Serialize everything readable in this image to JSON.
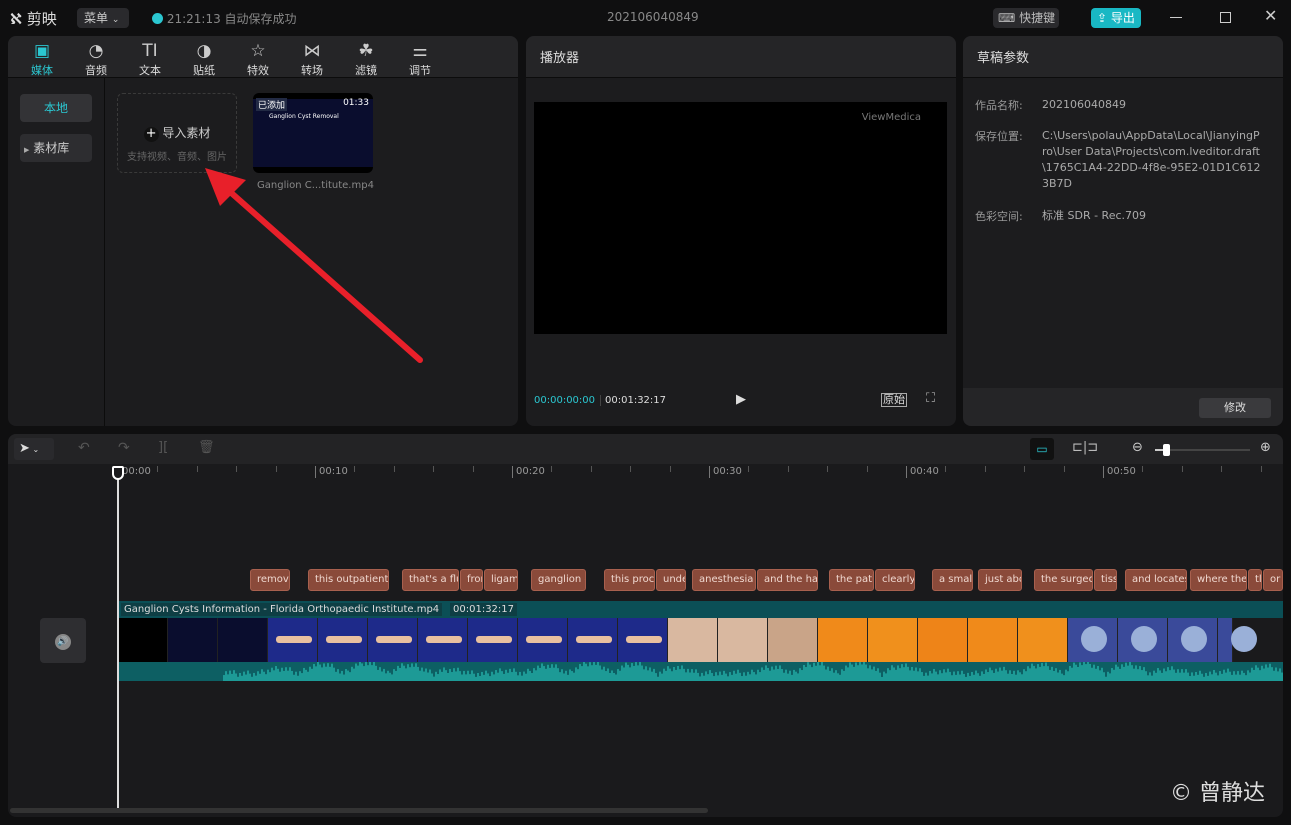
{
  "app": {
    "logo_text": "剪映",
    "menu_label": "菜单",
    "save_status": "21:21:13 自动保存成功",
    "project_title": "202106040849",
    "shortcuts_label": "快捷键",
    "export_label": "导出",
    "accent": "#2bc7d1"
  },
  "media_tabs": [
    {
      "label": "媒体",
      "icon": "media-icon",
      "active": true
    },
    {
      "label": "音频",
      "icon": "audio-icon"
    },
    {
      "label": "文本",
      "icon": "text-icon"
    },
    {
      "label": "贴纸",
      "icon": "sticker-icon"
    },
    {
      "label": "特效",
      "icon": "effects-icon"
    },
    {
      "label": "转场",
      "icon": "transition-icon"
    },
    {
      "label": "滤镜",
      "icon": "filter-icon"
    },
    {
      "label": "调节",
      "icon": "adjust-icon"
    }
  ],
  "media_sidebar": {
    "local": "本地",
    "library": "素材库"
  },
  "import": {
    "label": "导入素材",
    "hint": "支持视频、音频、图片"
  },
  "media_item": {
    "badge": "已添加",
    "duration": "01:33",
    "thumb_title": "Ganglion Cyst Removal",
    "filename": "Ganglion C...titute.mp4"
  },
  "player": {
    "title": "播放器",
    "watermark": "ViewMedica",
    "current_time": "00:00:00:00",
    "total_time": "00:01:32:17",
    "original_label": "原始"
  },
  "params": {
    "title": "草稿参数",
    "rows": [
      {
        "key": "作品名称:",
        "value": "202106040849"
      },
      {
        "key": "保存位置:",
        "value": "C:\\Users\\polau\\AppData\\Local\\JianyingPro\\User Data\\Projects\\com.lveditor.draft\\1765C1A4-22DD-4f8e-95E2-01D1C6123B7D"
      },
      {
        "key": "色彩空间:",
        "value": "标准 SDR - Rec.709"
      }
    ],
    "modify_label": "修改"
  },
  "timeline": {
    "ruler": [
      "00:00",
      "00:10",
      "00:20",
      "00:30",
      "00:40",
      "00:50"
    ],
    "zoom_level": 0.12,
    "subtitles": [
      "remova",
      "this outpatient",
      "that's a flu",
      "fror",
      "ligam",
      "ganglion c",
      "this proc",
      "unde",
      "anesthesia",
      "and the ha",
      "the pati",
      "clearly",
      "a smal",
      "just abo",
      "the surgeo",
      "tiss",
      "and locates",
      "where the",
      "tl",
      "or"
    ],
    "clip": {
      "name": "Ganglion Cysts Information - Florida Orthopaedic Institute.mp4",
      "duration": "00:01:32:17"
    }
  },
  "watermark": "© 曾静达"
}
